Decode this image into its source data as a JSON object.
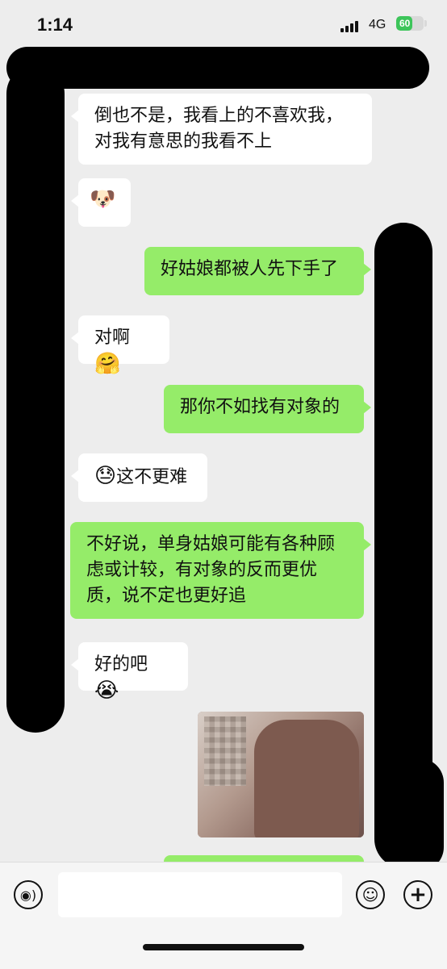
{
  "status": {
    "time": "1:14",
    "network": "4G",
    "battery": "60",
    "battery_level": 0.6
  },
  "messages": [
    {
      "side": "left",
      "text": "倒也不是，我看上的不喜欢我，对我有意思的我看不上"
    },
    {
      "side": "left",
      "text": "🐶"
    },
    {
      "side": "right",
      "text": "好姑娘都被人先下手了"
    },
    {
      "side": "left",
      "text": "对啊",
      "emoji": "🤗"
    },
    {
      "side": "right",
      "text": "那你不如找有对象的"
    },
    {
      "side": "left",
      "text": "这不更难",
      "emoji": "😓"
    },
    {
      "side": "right",
      "text": "不好说，单身姑娘可能有各种顾虑或计较，有对象的反而更优质，说不定也更好追"
    },
    {
      "side": "left",
      "text": "好的吧",
      "emoji": "😭"
    }
  ],
  "input_bar": {
    "placeholder": "",
    "voice_icon": "voice-icon",
    "emoji_icon": "emoji-icon",
    "plus_icon": "plus-icon"
  },
  "colors": {
    "background": "#ededed",
    "left_bubble": "#ffffff",
    "right_bubble": "#95ec69",
    "redaction": "#000000"
  }
}
